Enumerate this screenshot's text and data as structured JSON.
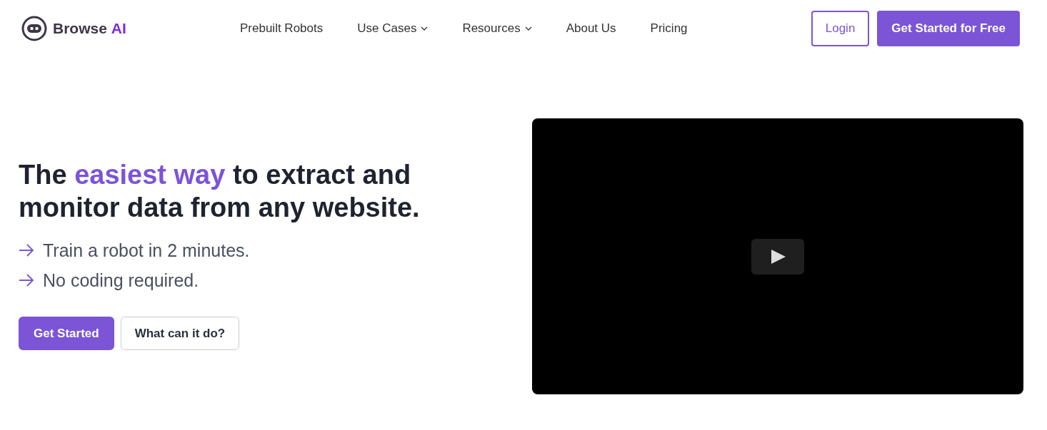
{
  "logo": {
    "name": "Browse",
    "accent": "AI"
  },
  "nav": [
    {
      "label": "Prebuilt Robots",
      "dropdown": false
    },
    {
      "label": "Use Cases",
      "dropdown": true
    },
    {
      "label": "Resources",
      "dropdown": true
    },
    {
      "label": "About Us",
      "dropdown": false
    },
    {
      "label": "Pricing",
      "dropdown": false
    }
  ],
  "header_buttons": [
    {
      "label": "Login",
      "kind": "outline"
    },
    {
      "label": "Get Started for Free",
      "kind": "primary"
    }
  ],
  "headline": [
    {
      "text": "The ",
      "highlight": false
    },
    {
      "text": "easiest way",
      "highlight": true
    },
    {
      "text": " to extract and monitor data from any website.",
      "highlight": false
    }
  ],
  "points": [
    "Train a robot in 2 minutes.",
    "No coding required."
  ],
  "hero_buttons": [
    {
      "label": "Get Started",
      "kind": "primary"
    },
    {
      "label": "What can it do?",
      "kind": "secondary"
    }
  ],
  "video": {
    "kind": "video"
  }
}
